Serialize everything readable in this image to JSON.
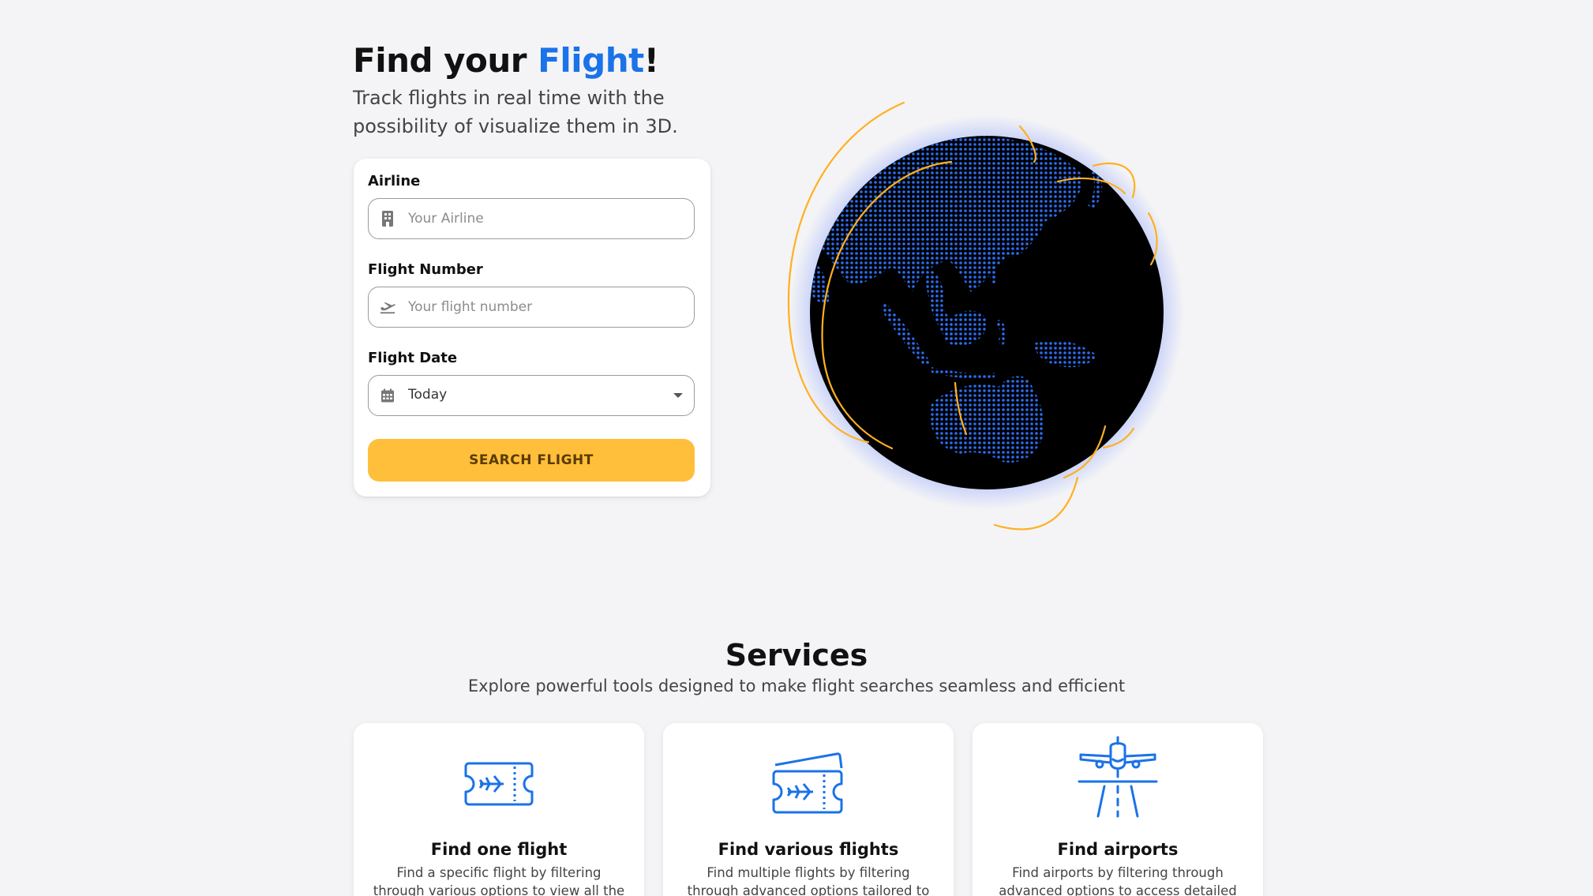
{
  "hero": {
    "title_prefix": "Find your ",
    "title_accent": "Flight",
    "title_suffix": "!",
    "subtitle": "Track flights in real time with the possibility of visualize them in 3D."
  },
  "form": {
    "airline_label": "Airline",
    "airline_placeholder": "Your Airline",
    "airline_value": "",
    "flight_number_label": "Flight Number",
    "flight_number_placeholder": "Your flight number",
    "flight_number_value": "",
    "flight_date_label": "Flight Date",
    "flight_date_value": "Today",
    "search_button": "SEARCH FLIGHT"
  },
  "services": {
    "title": "Services",
    "subtitle": "Explore powerful tools designed to make flight searches seamless and efficient",
    "cards": [
      {
        "title": "Find one flight",
        "description": "Find a specific flight by filtering through various options to view all the",
        "icon": "ticket-icon"
      },
      {
        "title": "Find various flights",
        "description": "Find multiple flights by filtering through advanced options tailored to your",
        "icon": "tickets-icon"
      },
      {
        "title": "Find airports",
        "description": "Find airports by filtering through advanced options to access detailed",
        "icon": "airport-runway-icon"
      }
    ]
  },
  "colors": {
    "accent": "#1a73e8",
    "button": "#ffbf3b",
    "globe_land": "#2a6cf0",
    "orbit": "#ffb020",
    "background": "#f4f4f6"
  }
}
